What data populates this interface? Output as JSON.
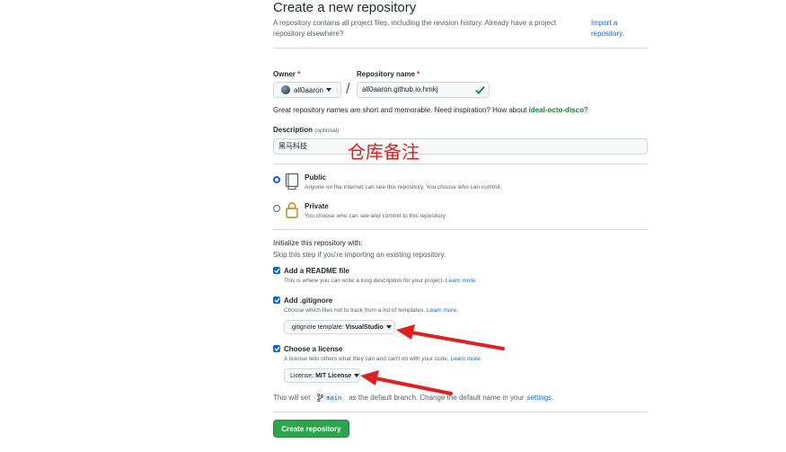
{
  "header": {
    "title": "Create a new repository",
    "intro": "A repository contains all project files, including the revision history. Already have a project repository elsewhere?",
    "import_link": "Import a repository."
  },
  "owner": {
    "label": "Owner",
    "required_mark": "*",
    "value": "all0aaron"
  },
  "separator": "/",
  "repo_name": {
    "label": "Repository name",
    "required_mark": "*",
    "value": "all0aaron.github.io.hmkj",
    "valid": true
  },
  "name_hint": {
    "text": "Great repository names are short and memorable. Need inspiration? How about",
    "suggestion": "ideal-octo-disco",
    "suffix": "?"
  },
  "description": {
    "label": "Description",
    "optional": "(optional)",
    "value": "黑马科技"
  },
  "annotation": {
    "text": "仓库备注",
    "color": "#e02020"
  },
  "visibility": {
    "selected": "Public",
    "options": [
      {
        "title": "Public",
        "desc": "Anyone on the internet can see this repository. You choose who can commit."
      },
      {
        "title": "Private",
        "desc": "You choose who can see and commit to this repository."
      }
    ]
  },
  "init": {
    "heading": "Initialize this repository with:",
    "sub": "Skip this step if you're importing an existing repository.",
    "readme": {
      "label": "Add a README file",
      "desc": "This is where you can write a long description for your project.",
      "link": "Learn more.",
      "checked": true
    },
    "gitignore": {
      "label": "Add .gitignore",
      "desc": "Choose which files not to track from a list of templates.",
      "link": "Learn more.",
      "checked": true,
      "select_prefix": ".gitignore template:",
      "select_value": "VisualStudio"
    },
    "license": {
      "label": "Choose a license",
      "desc": "A license tells others what they can and can't do with your code.",
      "link": "Learn more.",
      "checked": true,
      "select_prefix": "License:",
      "select_value": "MIT License"
    }
  },
  "branch_note": {
    "prefix": "This will set",
    "branch": "main",
    "middle": "as the default branch. Change the default name in your",
    "link": "settings",
    "suffix": "."
  },
  "submit": "Create repository",
  "colors": {
    "primary_green": "#2da44e",
    "link_blue": "#0969da",
    "arrow_red": "#e02020"
  }
}
